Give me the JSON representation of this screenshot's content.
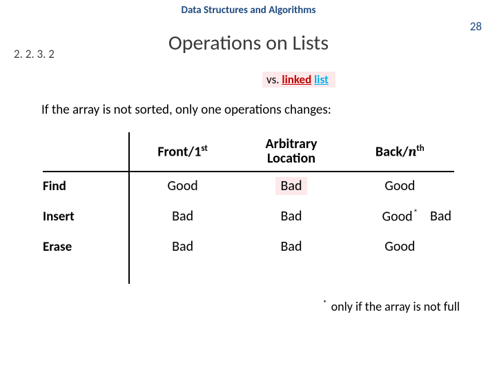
{
  "course_title": "Data Structures and Algorithms",
  "page_number": "28",
  "section_number": "2. 2. 3. 2",
  "slide_title": "Operations on Lists",
  "vs": {
    "prefix": "vs. ",
    "linked": "linked",
    "space": " ",
    "list": "list"
  },
  "lead": "If the array is not sorted, only one operations changes:",
  "headers": {
    "front": "Front/1",
    "front_sup": "st",
    "arbitrary_l1": "Arbitrary",
    "arbitrary_l2": "Location",
    "back_prefix": "Back/",
    "back_n": "n",
    "back_sup": "th"
  },
  "rows": {
    "find": {
      "label": "Find",
      "front": "Good",
      "arb": "Bad",
      "back": "Good"
    },
    "insert": {
      "label": "Insert",
      "front": "Bad",
      "arb": "Bad",
      "back_main": "Good",
      "back_star": "*",
      "back_aside": "Bad"
    },
    "erase": {
      "label": "Erase",
      "front": "Bad",
      "arb": "Bad",
      "back": "Good"
    }
  },
  "footnote": {
    "star": "*",
    "text": " only if the array is not full"
  }
}
